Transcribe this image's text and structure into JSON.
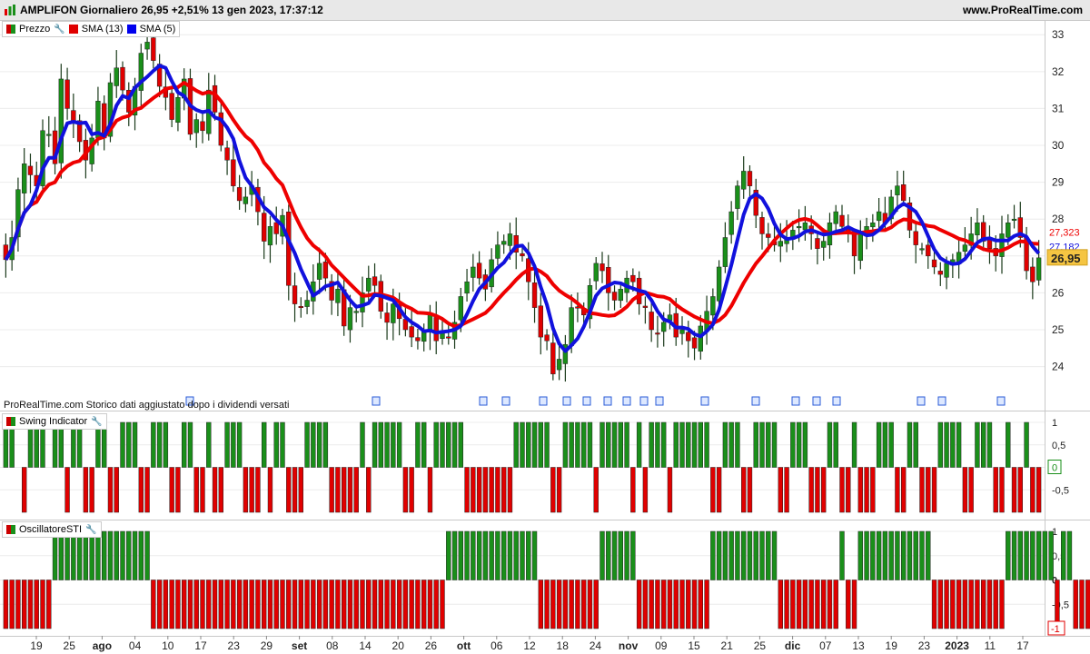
{
  "header": {
    "title": "AMPLIFON Giornaliero 26,95 +2,51% 13 gen 2023, 17:37:12",
    "site": "www.ProRealTime.com"
  },
  "legends": {
    "price": "Prezzo",
    "sma13": "SMA (13)",
    "sma5": "SMA (5)",
    "swing": "Swing Indicator",
    "sti": "OscillatoreSTI"
  },
  "note": "ProRealTime.com Storico dati aggiustato dopo i dividendi versati",
  "colors": {
    "up": "#1a8f1a",
    "down": "#e00000",
    "sma13": "#ee0000",
    "sma5": "#1111dd",
    "bg": "#ffffff"
  },
  "icons": [
    "wrench-icon",
    "prorealtime-logo",
    "dividend-icon"
  ],
  "chart_data": [
    {
      "type": "candlestick",
      "title": "AMPLIFON Giornaliero",
      "ylim": [
        23.3,
        33.4
      ],
      "yticks": [
        "33",
        "32",
        "31",
        "30",
        "29",
        "28",
        "27",
        "26",
        "25",
        "24"
      ],
      "xticks": [
        "19",
        "25",
        "ago",
        "04",
        "10",
        "17",
        "23",
        "29",
        "set",
        "08",
        "14",
        "20",
        "26",
        "ott",
        "06",
        "12",
        "18",
        "24",
        "nov",
        "09",
        "15",
        "21",
        "25",
        "dic",
        "07",
        "13",
        "19",
        "23",
        "2023",
        "11",
        "17"
      ],
      "price_labels": {
        "sma13": "27,323",
        "sma5": "27,182",
        "last": "26,95"
      },
      "closes": [
        26.9,
        27.5,
        28.8,
        29.5,
        29.2,
        28.9,
        30.4,
        30.3,
        29.5,
        31.8,
        31.0,
        30.6,
        30.1,
        29.6,
        30.2,
        31.2,
        30.2,
        31.7,
        32.1,
        31.5,
        30.9,
        31.6,
        32.5,
        32.8,
        32.3,
        31.6,
        31.3,
        30.7,
        31.3,
        31.8,
        30.3,
        30.7,
        30.4,
        31.5,
        30.9,
        30.0,
        29.6,
        28.9,
        28.5,
        28.6,
        28.9,
        28.2,
        27.4,
        27.8,
        27.6,
        28.1,
        26.2,
        25.7,
        25.6,
        25.8,
        26.3,
        26.8,
        26.4,
        25.8,
        26.1,
        25.1,
        25.6,
        25.5,
        26.0,
        26.4,
        26.2,
        25.5,
        25.2,
        25.7,
        25.3,
        25.0,
        24.8,
        24.7,
        25.0,
        25.4,
        24.7,
        24.9,
        24.8,
        25.2,
        25.9,
        26.3,
        26.7,
        26.4,
        26.1,
        26.9,
        27.3,
        27.4,
        27.6,
        27.1,
        27.0,
        26.3,
        25.6,
        24.8,
        24.7,
        23.8,
        24.2,
        24.6,
        25.6,
        25.6,
        25.4,
        26.2,
        26.8,
        26.6,
        26.0,
        25.8,
        26.1,
        26.4,
        26.3,
        25.7,
        25.6,
        25.0,
        24.9,
        25.2,
        25.4,
        24.8,
        25.0,
        24.7,
        24.5,
        25.1,
        25.5,
        25.9,
        26.7,
        27.5,
        28.2,
        28.9,
        29.3,
        28.9,
        28.1,
        27.6,
        27.5,
        27.3,
        27.4,
        27.5,
        27.7,
        27.8,
        27.9,
        27.6,
        27.2,
        27.4,
        27.9,
        28.2,
        27.8,
        27.6,
        27.0,
        27.6,
        27.8,
        27.9,
        28.2,
        27.9,
        28.6,
        28.9,
        28.5,
        27.7,
        27.3,
        27.2,
        27.0,
        26.7,
        26.5,
        26.8,
        26.9,
        27.1,
        27.3,
        27.6,
        27.9,
        27.4,
        27.2,
        27.0,
        27.6,
        27.9,
        28.0,
        27.5,
        26.6,
        26.3,
        26.95
      ]
    },
    {
      "type": "bar",
      "title": "Swing Indicator",
      "ylim": [
        -1,
        1
      ],
      "yticks": [
        "1",
        "0,5",
        "0",
        "-0,5"
      ],
      "last_value_label": "0",
      "values": [
        1,
        1,
        0,
        -1,
        1,
        1,
        1,
        0,
        1,
        1,
        -1,
        1,
        1,
        -1,
        -1,
        1,
        1,
        -1,
        -1,
        1,
        1,
        1,
        -1,
        -1,
        1,
        1,
        1,
        -1,
        -1,
        1,
        1,
        -1,
        -1,
        1,
        -1,
        -1,
        1,
        1,
        1,
        -1,
        -1,
        -1,
        1,
        -1,
        1,
        1,
        -1,
        -1,
        -1,
        1,
        1,
        1,
        1,
        -1,
        -1,
        -1,
        -1,
        -1,
        1,
        -1,
        1,
        1,
        1,
        1,
        1,
        -1,
        -1,
        1,
        1,
        -1,
        1,
        1,
        1,
        1,
        1,
        -1,
        -1,
        -1,
        -1,
        -1,
        -1,
        -1,
        -1,
        1,
        1,
        1,
        1,
        1,
        1,
        -1,
        -1,
        1,
        1,
        1,
        1,
        1,
        -1,
        1,
        1,
        1,
        1,
        1,
        -1,
        1,
        -1,
        1,
        1,
        1,
        -1,
        1,
        1,
        1,
        1,
        1,
        1,
        -1,
        -1,
        1,
        1,
        1,
        -1,
        -1,
        1,
        1,
        1,
        1,
        -1,
        -1,
        1,
        1,
        1,
        -1,
        -1,
        -1,
        1,
        1,
        -1,
        -1,
        1,
        -1,
        -1,
        -1,
        1,
        1,
        1,
        -1,
        -1,
        1,
        1,
        -1,
        -1,
        -1,
        1,
        1,
        1,
        1,
        -1,
        -1,
        1,
        1,
        1,
        -1,
        -1,
        1,
        -1,
        -1,
        1,
        -1,
        -1,
        0
      ]
    },
    {
      "type": "bar",
      "title": "OscillatoreSTI",
      "ylim": [
        -1,
        1
      ],
      "yticks": [
        "1",
        "0,5",
        "0",
        "-0,5"
      ],
      "last_value_label": "-1",
      "values": [
        -1,
        -1,
        -1,
        -1,
        -1,
        -1,
        -1,
        -1,
        1,
        1,
        1,
        1,
        1,
        1,
        1,
        1,
        1,
        1,
        1,
        1,
        1,
        1,
        1,
        1,
        -1,
        -1,
        -1,
        -1,
        -1,
        -1,
        -1,
        -1,
        -1,
        -1,
        -1,
        -1,
        -1,
        -1,
        -1,
        -1,
        -1,
        -1,
        -1,
        -1,
        -1,
        -1,
        -1,
        -1,
        -1,
        -1,
        -1,
        -1,
        -1,
        -1,
        -1,
        -1,
        -1,
        -1,
        -1,
        -1,
        -1,
        -1,
        -1,
        -1,
        -1,
        -1,
        -1,
        -1,
        -1,
        -1,
        -1,
        -1,
        1,
        1,
        1,
        1,
        1,
        1,
        1,
        1,
        1,
        1,
        1,
        1,
        1,
        1,
        1,
        -1,
        -1,
        -1,
        -1,
        -1,
        -1,
        -1,
        -1,
        -1,
        -1,
        1,
        1,
        1,
        1,
        1,
        1,
        -1,
        -1,
        -1,
        -1,
        -1,
        -1,
        -1,
        -1,
        -1,
        -1,
        -1,
        -1,
        1,
        1,
        1,
        1,
        1,
        1,
        1,
        1,
        1,
        1,
        1,
        -1,
        -1,
        -1,
        -1,
        -1,
        -1,
        -1,
        -1,
        -1,
        -1,
        1,
        -1,
        -1,
        1,
        1,
        1,
        1,
        1,
        1,
        1,
        1,
        1,
        1,
        1,
        1,
        -1,
        -1,
        -1,
        -1,
        -1,
        -1,
        -1,
        -1,
        -1,
        -1,
        -1,
        -1,
        1,
        1,
        1,
        1,
        1,
        1,
        1,
        1,
        -1,
        1,
        1,
        -1,
        -1,
        -1
      ]
    }
  ]
}
